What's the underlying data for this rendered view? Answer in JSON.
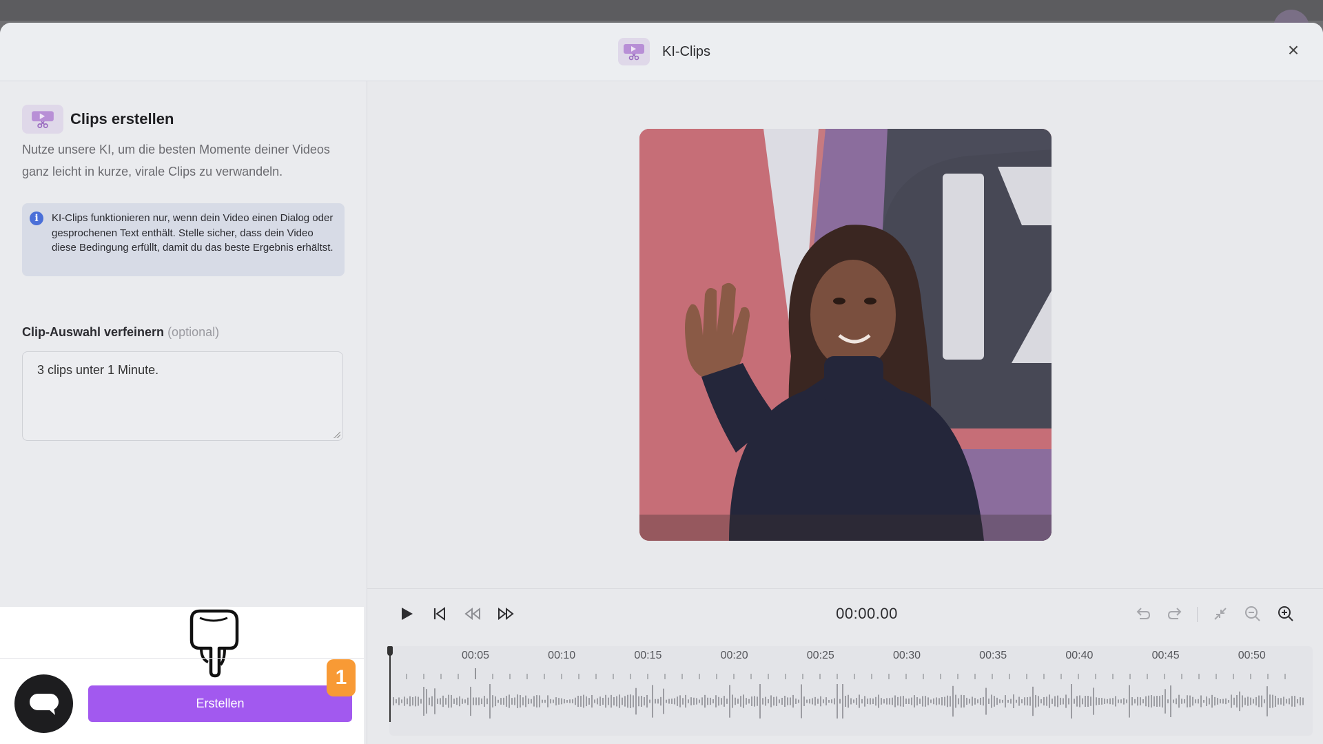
{
  "modal": {
    "title": "KI-Clips",
    "close_label": "×"
  },
  "left": {
    "section_title": "Clips erstellen",
    "description": "Nutze unsere KI, um die besten Momente deiner Videos ganz leicht in kurze, virale Clips zu verwandeln.",
    "info_text": "KI-Clips funktionieren nur, wenn dein Video einen Dialog oder gesprochenen Text enthält. Stelle sicher, dass dein Video diese Bedingung erfüllt, damit du das beste Ergebnis erhältst.",
    "refine_label": "Clip-Auswahl verfeinern",
    "refine_optional": "(optional)",
    "refine_value": "3 clips unter 1 Minute.",
    "create_button": "Erstellen",
    "step_badge": "1"
  },
  "player": {
    "timecode": "00:00.00"
  },
  "timeline": {
    "ticks": [
      "00:05",
      "00:10",
      "00:15",
      "00:20",
      "00:25",
      "00:30",
      "00:35",
      "00:40",
      "00:45",
      "00:50"
    ],
    "playhead_time": "00:00.00"
  },
  "colors": {
    "accent": "#a259ef",
    "badge": "#f89a35",
    "info_icon": "#4a6fd8"
  },
  "icons": {
    "title": "ai-clips-icon",
    "info": "info-icon",
    "chat": "chat-bubble-icon",
    "pointer": "pointing-hand-icon",
    "controls": [
      "play-icon",
      "skip-to-start-icon",
      "rewind-icon",
      "fast-forward-icon",
      "undo-icon",
      "redo-icon",
      "collapse-icon",
      "zoom-out-icon",
      "zoom-in-icon"
    ]
  }
}
